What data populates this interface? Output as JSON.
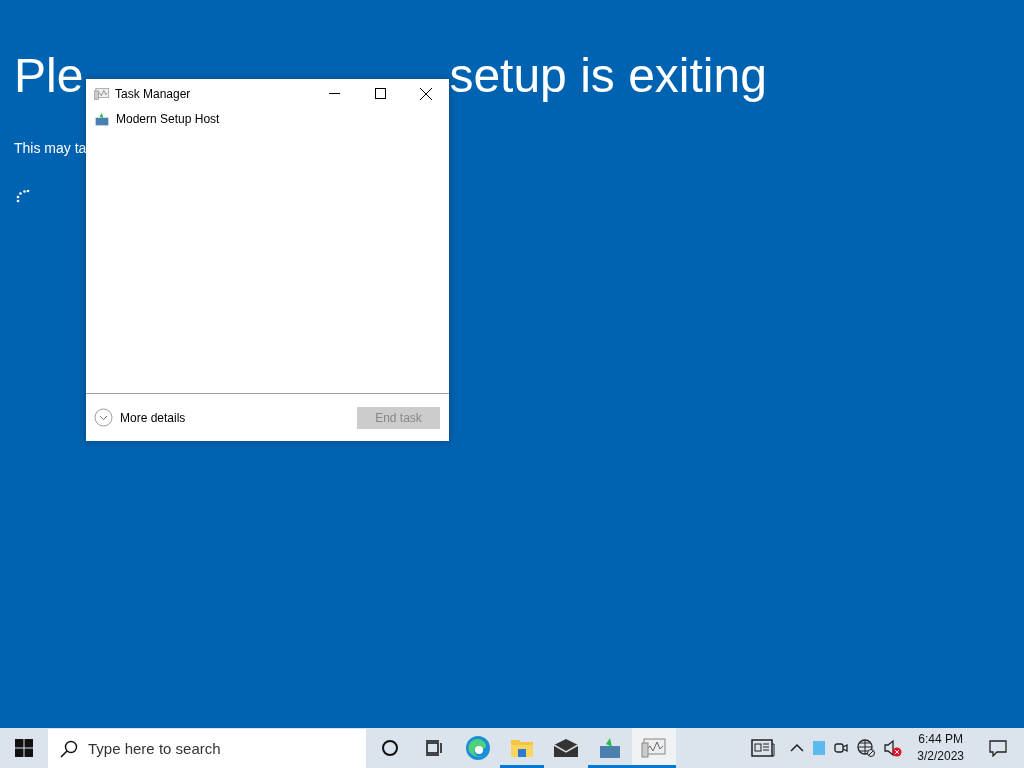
{
  "setup_screen": {
    "heading_parts": [
      "Ple",
      "setup is exiting"
    ],
    "subtitle": "This may ta"
  },
  "task_manager": {
    "title": "Task Manager",
    "apps": [
      {
        "name": "Modern Setup Host"
      }
    ],
    "more_details": "More details",
    "end_task": {
      "label": "End task",
      "disabled": true
    }
  },
  "taskbar": {
    "search": {
      "placeholder": "Type here to search"
    },
    "apps": [
      {
        "kind": "cortana",
        "running": false,
        "selected": false
      },
      {
        "kind": "taskview",
        "running": false,
        "selected": false
      },
      {
        "kind": "edge",
        "running": false,
        "selected": false
      },
      {
        "kind": "explorer",
        "running": true,
        "selected": false
      },
      {
        "kind": "mail",
        "running": false,
        "selected": false
      },
      {
        "kind": "setup",
        "running": true,
        "selected": false
      },
      {
        "kind": "taskmgr",
        "running": true,
        "selected": true
      }
    ],
    "clock": {
      "time": "6:44 PM",
      "date": "3/2/2023"
    }
  }
}
